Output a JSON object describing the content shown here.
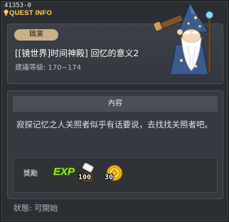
{
  "window": {
    "quest_id": "41353-0",
    "title": "QUEST INFO"
  },
  "header": {
    "job_badge": "職業",
    "quest_title": "[[镜世界]时间神殿] 回忆的意义2",
    "level_text": "建議等級: 170~174",
    "npc_icon": "wizard-npc"
  },
  "content": {
    "section_title": "內容",
    "description": "寂探记忆之人关照者似乎有话要说，去找找关照者吧。"
  },
  "rewards": {
    "label": "獎勵",
    "exp_icon_text": "EXP",
    "items": [
      {
        "icon": "scroll-bag-icon",
        "count": "100"
      },
      {
        "icon": "gold-coin-icon",
        "count": "30"
      }
    ]
  },
  "status": {
    "text": "狀態: 可開始"
  },
  "colors": {
    "title_yellow": "#ffd54a",
    "badge_bg": "#c9b08a",
    "exp_green": "#9be22a"
  }
}
